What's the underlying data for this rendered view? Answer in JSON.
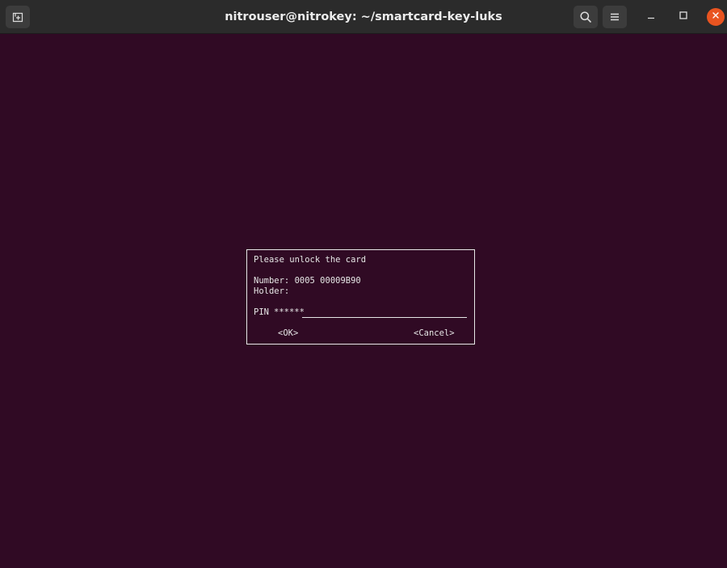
{
  "window": {
    "title": "nitrouser@nitrokey: ~/smartcard-key-luks"
  },
  "titlebar": {
    "icons": {
      "new_tab": "new-tab-icon",
      "search": "search-icon",
      "menu": "hamburger-menu-icon",
      "minimize": "minimize-icon",
      "maximize": "maximize-icon",
      "close": "close-icon"
    },
    "close_color": "#e95420"
  },
  "dialog": {
    "prompt": "Please unlock the card",
    "number_line": "Number: 0005 00009B90",
    "holder_line": "Holder:",
    "pin_label": "PIN",
    "pin_value": "******",
    "ok_label": "<OK>",
    "cancel_label": "<Cancel>"
  },
  "colors": {
    "terminal_background": "#300a24",
    "titlebar_background": "#2b2b2b",
    "text": "#e6e6e6"
  }
}
